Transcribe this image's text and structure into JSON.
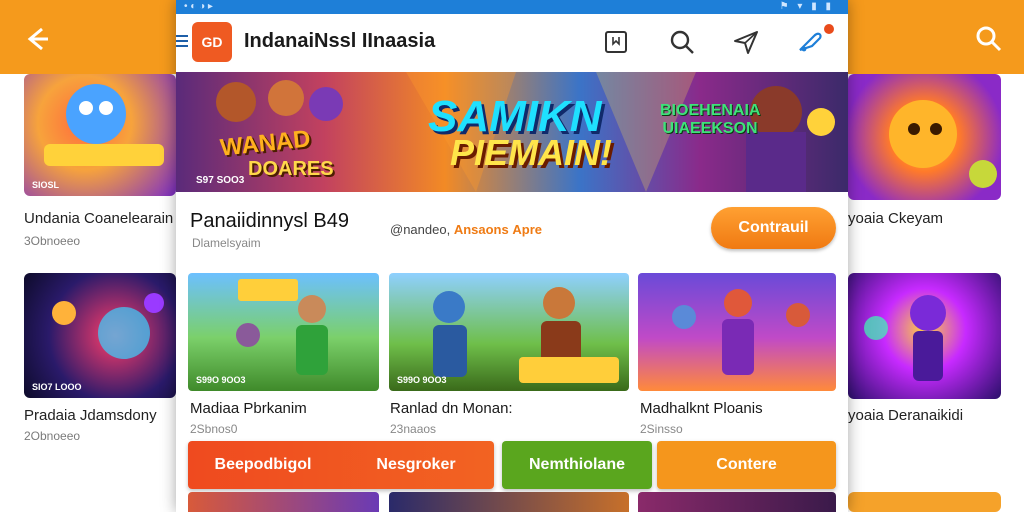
{
  "background": {
    "left_cards": [
      {
        "title": "Undania Coanelearain",
        "sub": "3Obnoeeo",
        "tag": "SIOSL"
      },
      {
        "title": "Pradaia Jdamsdony",
        "sub": "2Obnoeeo",
        "tag": "SIO7 LOOO"
      }
    ],
    "right_cards": [
      {
        "title": "yoaia Ckeyam"
      },
      {
        "title": "yoaia Deranaikidi"
      }
    ]
  },
  "statusbar": {
    "left": "• ◐ ◑ ▸",
    "right": "⚑ ▾ ▮ ▮"
  },
  "app": {
    "logo_text": "GD",
    "title": "IndanaiNssl IInaasia"
  },
  "banner": {
    "left_text": "WANAD",
    "left_sub": "DOARES",
    "main_line1": "SAMIKN",
    "main_line2": "PIEMAIN!",
    "right_text": "BIOEHENAIA UIAEEKSON",
    "tag": "S97 SOO3"
  },
  "game": {
    "title": "Panaiidinnysl B49",
    "developer": "Dlamelsyaim",
    "meta_prefix": "@nandeo,",
    "meta_highlight": "Ansaons",
    "meta_suffix": "Apre",
    "continue_label": "Contrauil"
  },
  "cards": [
    {
      "title": "Madiaa Pbrkanim",
      "sub": "2Sbnos0",
      "tag": "S99O 9OO3"
    },
    {
      "title": "Ranlad dn Monan:",
      "sub": "23naaos",
      "tag": "S99O 9OO3"
    },
    {
      "title": "Madhalknt Ploanis",
      "sub": "2Sinsso",
      "tag": ""
    }
  ],
  "actions": [
    {
      "label": "Beepodbigol",
      "color": "#ef4a1f"
    },
    {
      "label": "Nesgroker",
      "color": "#ef5a1f"
    },
    {
      "label": "Nemthiolane",
      "color": "#5aa61e"
    },
    {
      "label": "Contere",
      "color": "#f5961c"
    }
  ],
  "colors": {
    "accent_orange": "#f59a1c",
    "status_blue": "#1e7fd8",
    "progress_blue": "#2a8fd8"
  }
}
